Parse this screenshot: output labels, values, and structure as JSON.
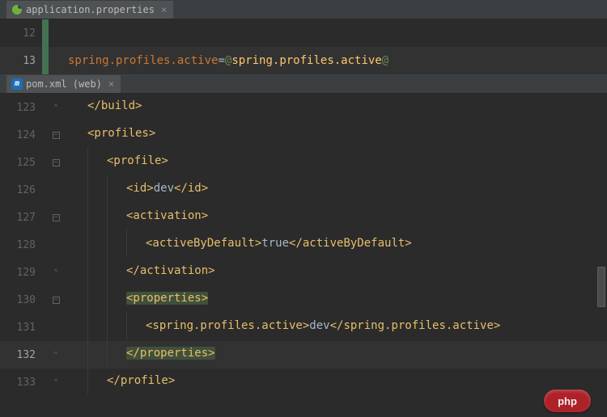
{
  "top_editor": {
    "tab": {
      "label": "application.properties",
      "icon": "spring-icon"
    },
    "lines": [
      {
        "num": "12",
        "current": false,
        "stripe": "green",
        "fold": null,
        "tokens": []
      },
      {
        "num": "13",
        "current": true,
        "stripe": "green",
        "fold": null,
        "tokens": [
          {
            "t": "spring.profiles.active",
            "cls": "c-orange"
          },
          {
            "t": "=",
            "cls": "c-text"
          },
          {
            "t": "@",
            "cls": "c-green"
          },
          {
            "t": "spring.profiles.active",
            "cls": "c-yellow"
          },
          {
            "t": "@",
            "cls": "c-green"
          }
        ]
      }
    ]
  },
  "bottom_editor": {
    "tab": {
      "label": "pom.xml (web)",
      "icon": "maven-icon",
      "icon_letter": "m"
    },
    "lines": [
      {
        "num": "123",
        "fold": "up",
        "indent": 1,
        "tokens": [
          {
            "t": "</build>",
            "cls": "c-tag"
          }
        ]
      },
      {
        "num": "124",
        "fold": "open",
        "indent": 1,
        "tokens": [
          {
            "t": "<profiles>",
            "cls": "c-tag"
          }
        ]
      },
      {
        "num": "125",
        "fold": "open",
        "indent": 2,
        "tokens": [
          {
            "t": "<profile>",
            "cls": "c-tag"
          }
        ]
      },
      {
        "num": "126",
        "fold": null,
        "indent": 3,
        "tokens": [
          {
            "t": "<id>",
            "cls": "c-tag"
          },
          {
            "t": "dev",
            "cls": "c-text"
          },
          {
            "t": "</id>",
            "cls": "c-tag"
          }
        ]
      },
      {
        "num": "127",
        "fold": "open",
        "indent": 3,
        "tokens": [
          {
            "t": "<activation>",
            "cls": "c-tag"
          }
        ]
      },
      {
        "num": "128",
        "fold": null,
        "indent": 4,
        "tokens": [
          {
            "t": "<activeByDefault>",
            "cls": "c-tag"
          },
          {
            "t": "true",
            "cls": "c-text"
          },
          {
            "t": "</activeByDefault>",
            "cls": "c-tag"
          }
        ]
      },
      {
        "num": "129",
        "fold": "up",
        "indent": 3,
        "tokens": [
          {
            "t": "</activation>",
            "cls": "c-tag"
          }
        ]
      },
      {
        "num": "130",
        "fold": "open",
        "indent": 3,
        "tokens": [
          {
            "t": "<properties>",
            "cls": "c-tag",
            "hl": true
          }
        ]
      },
      {
        "num": "131",
        "fold": null,
        "indent": 4,
        "tokens": [
          {
            "t": "<spring.profiles.active>",
            "cls": "c-tag"
          },
          {
            "t": "dev",
            "cls": "c-text"
          },
          {
            "t": "</spring.profiles.active>",
            "cls": "c-tag"
          }
        ]
      },
      {
        "num": "132",
        "current": true,
        "fold": "up",
        "indent": 3,
        "tokens": [
          {
            "t": "</properties>",
            "cls": "c-tag",
            "hl": true
          }
        ]
      },
      {
        "num": "133",
        "fold": "up",
        "indent": 2,
        "tokens": [
          {
            "t": "</profile>",
            "cls": "c-tag"
          }
        ]
      }
    ]
  },
  "watermark": "php",
  "close_glyph": "×",
  "fold_minus": "−"
}
